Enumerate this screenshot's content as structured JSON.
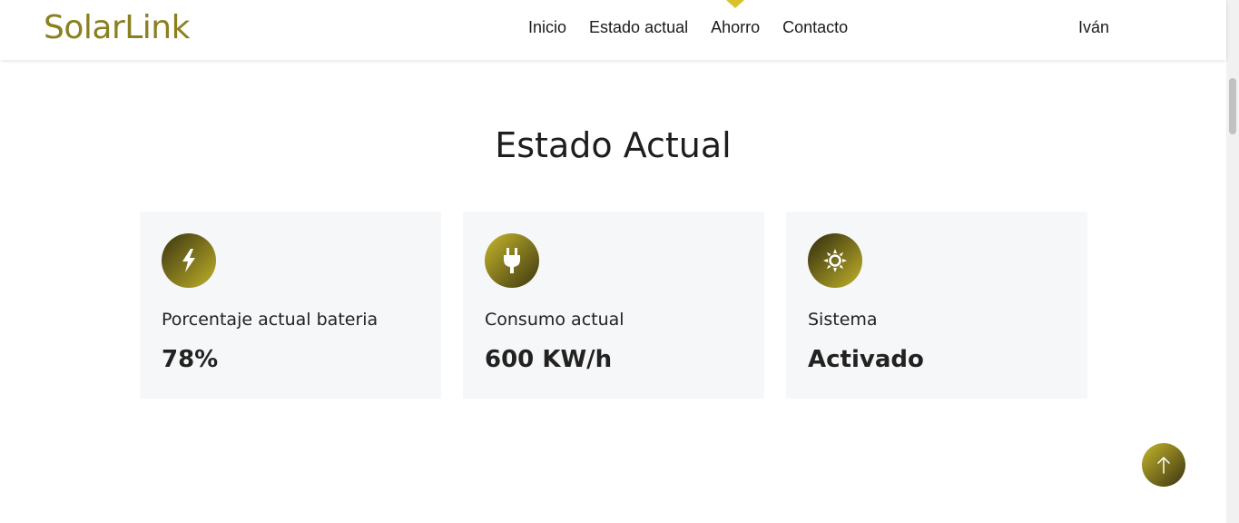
{
  "header": {
    "logo": "SolarLink",
    "nav": [
      {
        "label": "Inicio"
      },
      {
        "label": "Estado actual"
      },
      {
        "label": "Ahorro",
        "active": true
      },
      {
        "label": "Contacto"
      }
    ],
    "user": "Iván"
  },
  "section": {
    "title": "Estado Actual",
    "cards": [
      {
        "icon": "lightning-icon",
        "label": "Porcentaje actual bateria",
        "value": "78%"
      },
      {
        "icon": "plug-icon",
        "label": "Consumo actual",
        "value": "600 KW/h"
      },
      {
        "icon": "sun-icon",
        "label": "Sistema",
        "value": "Activado"
      }
    ]
  },
  "back_to_top": {
    "icon": "arrow-up-icon"
  },
  "colors": {
    "brand": "#8a8020",
    "accent": "#d8c22a",
    "card_bg": "#f6f7f8",
    "icon_dark": "#3b3410",
    "icon_light": "#bfb12a"
  }
}
